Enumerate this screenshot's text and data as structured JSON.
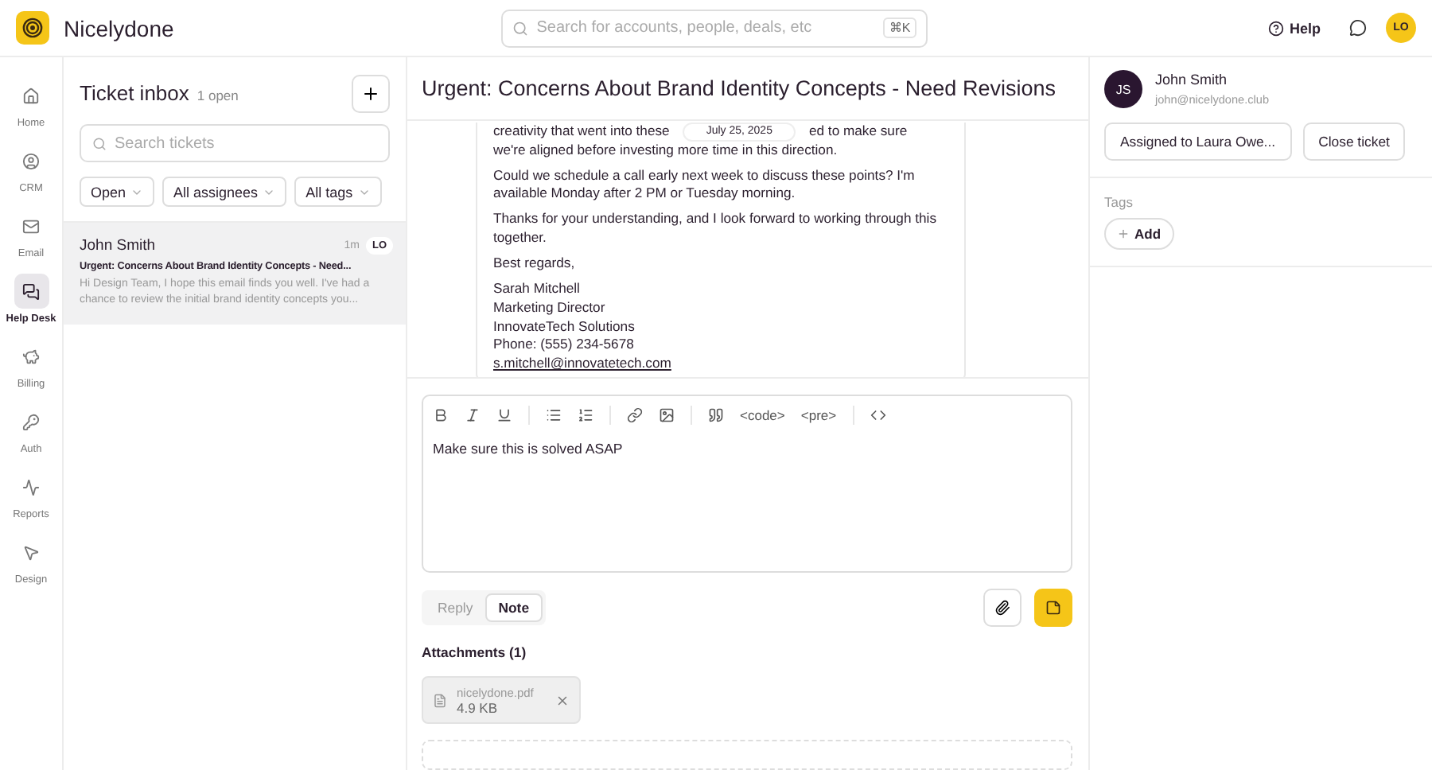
{
  "app": {
    "name": "Nicelydone"
  },
  "search": {
    "placeholder": "Search for accounts, people, deals, etc",
    "shortcut": "⌘K"
  },
  "header_actions": {
    "help": "Help",
    "avatar": "LO"
  },
  "nav": [
    {
      "label": "Home",
      "selected": false
    },
    {
      "label": "CRM",
      "selected": false
    },
    {
      "label": "Email",
      "selected": false
    },
    {
      "label": "Help Desk",
      "selected": true
    },
    {
      "label": "Billing",
      "selected": false
    },
    {
      "label": "Auth",
      "selected": false
    },
    {
      "label": "Reports",
      "selected": false
    },
    {
      "label": "Design",
      "selected": false
    }
  ],
  "inbox": {
    "title": "Ticket inbox",
    "count": "1 open",
    "search_placeholder": "Search tickets",
    "filters": [
      "Open",
      "All assignees",
      "All tags"
    ],
    "tickets": [
      {
        "name": "John Smith",
        "time": "1m",
        "assignee": "LO",
        "subject": "Urgent: Concerns About Brand Identity Concepts - Need...",
        "preview": "Hi Design Team, I hope this email finds you well. I've had a chance to review the initial brand identity concepts you...",
        "selected": true
      }
    ]
  },
  "ticket": {
    "title": "Urgent: Concerns About Brand Identity Concepts - Need Revisions",
    "date": "July 25, 2025",
    "cut_line_start": "creativity that went into these",
    "cut_line_end": "ed to make sure",
    "paragraphs": [
      "we're aligned before investing more time in this direction.",
      "Could we schedule a call early next week to discuss these points? I'm available Monday after 2 PM or Tuesday morning.",
      "Thanks for your understanding, and I look forward to working through this together.",
      "Best regards,"
    ],
    "signature": [
      "Sarah Mitchell",
      "Marketing Director",
      "InnovateTech Solutions",
      "Phone: (555) 234-5678"
    ],
    "email_link": "s.mitchell@innovatetech.com"
  },
  "editor": {
    "code_buttons": [
      "<code>",
      "<pre>"
    ],
    "text": "Make sure this is solved ASAP",
    "modes": [
      {
        "label": "Reply",
        "selected": false
      },
      {
        "label": "Note",
        "selected": true
      }
    ],
    "attachments_title": "Attachments (1)",
    "attachments": [
      {
        "name": "nicelydone.pdf",
        "size": "4.9 KB"
      }
    ]
  },
  "contact": {
    "initials": "JS",
    "name": "John Smith",
    "email": "john@nicelydone.club",
    "assign_button": "Assigned to Laura Owe...",
    "close_button": "Close ticket",
    "tags_label": "Tags",
    "add_tag": "Add"
  }
}
